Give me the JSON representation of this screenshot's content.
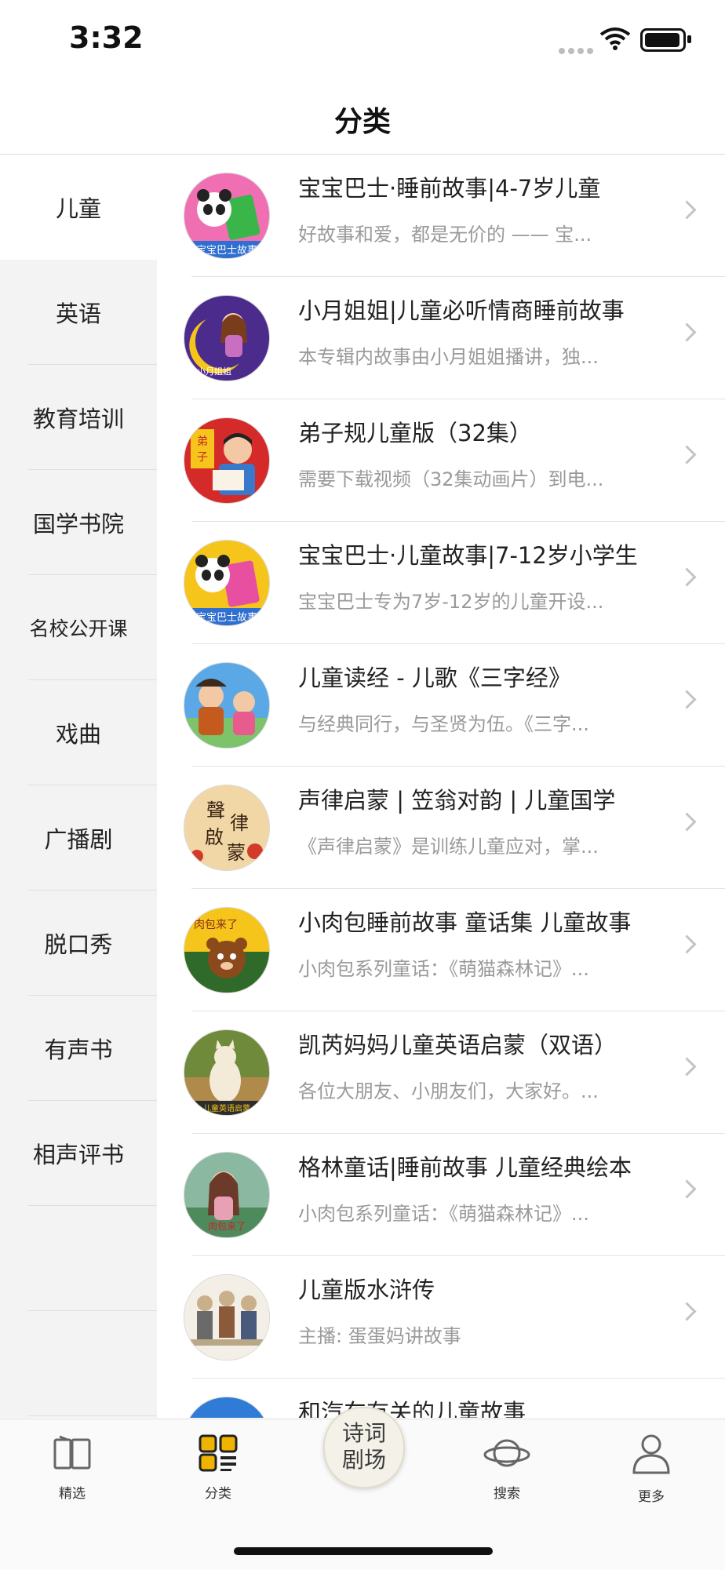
{
  "status_bar": {
    "time": "3:32"
  },
  "nav": {
    "title": "分类"
  },
  "sidebar": {
    "items": [
      {
        "label": "儿童",
        "active": true
      },
      {
        "label": "英语"
      },
      {
        "label": "教育培训"
      },
      {
        "label": "国学书院"
      },
      {
        "label": "名校公开课"
      },
      {
        "label": "戏曲"
      },
      {
        "label": "广播剧"
      },
      {
        "label": "脱口秀"
      },
      {
        "label": "有声书"
      },
      {
        "label": "相声评书"
      },
      {
        "label": ""
      },
      {
        "label": ""
      }
    ]
  },
  "list": {
    "items": [
      {
        "title": "宝宝巴士·睡前故事|4-7岁儿童",
        "subtitle": "好故事和爱，都是无价的 —— 宝...",
        "thumb_color": "#e84fa0",
        "thumb_icon": "panda-book-icon"
      },
      {
        "title": "小月姐姐|儿童必听情商睡前故事",
        "subtitle": "本专辑内故事由小月姐姐播讲，独...",
        "thumb_color": "#4b2c8c",
        "thumb_icon": "moon-girl-icon"
      },
      {
        "title": "弟子规儿童版（32集）",
        "subtitle": "需要下载视频（32集动画片）到电...",
        "thumb_color": "#c8222a",
        "thumb_icon": "reading-boy-icon"
      },
      {
        "title": "宝宝巴士·儿童故事|7-12岁小学生",
        "subtitle": "宝宝巴士专为7岁-12岁的儿童开设...",
        "thumb_color": "#f5c51b",
        "thumb_icon": "panda-book-icon"
      },
      {
        "title": "儿童读经 - 儿歌《三字经》",
        "subtitle": "与经典同行，与圣贤为伍。《三字...",
        "thumb_color": "#3c8fd8",
        "thumb_icon": "classic-kids-icon"
      },
      {
        "title": "声律启蒙 | 笠翁对韵 | 儿童国学",
        "subtitle": "《声律启蒙》是训练儿童应对，掌...",
        "thumb_color": "#f1d6a6",
        "thumb_icon": "calligraphy-icon"
      },
      {
        "title": "小肉包睡前故事 童话集 儿童故事",
        "subtitle": "小肉包系列童话：《萌猫森林记》...",
        "thumb_color": "#2f6a2a",
        "thumb_icon": "bear-icon"
      },
      {
        "title": "凯芮妈妈儿童英语启蒙（双语）",
        "subtitle": "各位大朋友、小朋友们，大家好。...",
        "thumb_color": "#b08a4a",
        "thumb_icon": "cat-icon"
      },
      {
        "title": "格林童话|睡前故事 儿童经典绘本",
        "subtitle": "小肉包系列童话：《萌猫森林记》...",
        "thumb_color": "#5f9a6e",
        "thumb_icon": "fairy-girl-icon"
      },
      {
        "title": "儿童版水浒传",
        "subtitle": "主播: 蛋蛋妈讲故事",
        "thumb_color": "#e8e2d8",
        "thumb_icon": "warriors-icon"
      },
      {
        "title": "和汽车有关的儿童故事",
        "subtitle": "",
        "thumb_color": "#2f7bd6",
        "thumb_icon": "car-icon"
      }
    ]
  },
  "tabbar": {
    "tabs": [
      {
        "label": "精选",
        "icon": "book-icon"
      },
      {
        "label": "分类",
        "icon": "grid-icon",
        "active": true
      },
      {
        "label": "诗词剧场",
        "icon": "poetry-theater-icon"
      },
      {
        "label": "搜索",
        "icon": "planet-icon"
      },
      {
        "label": "更多",
        "icon": "user-icon"
      }
    ],
    "center_line1": "诗词",
    "center_line2": "剧场"
  },
  "colors": {
    "accent": "#f0b400",
    "divider": "#e3e3e3",
    "sidebar_bg": "#f3f3f3"
  }
}
